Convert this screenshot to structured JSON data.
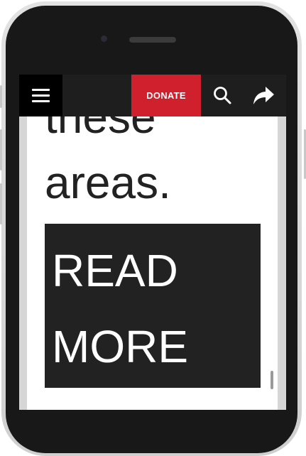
{
  "content": {
    "partial_text": "these",
    "areas_text": "areas.",
    "read_more_line1": "READ",
    "read_more_line2": "MORE"
  },
  "navbar": {
    "menu_icon": "hamburger-menu-icon",
    "donate_label": "DONATE",
    "search_icon": "search-icon",
    "share_icon": "share-arrow-icon"
  },
  "colors": {
    "navbar_bg": "#1e1e1e",
    "menu_bg": "#000000",
    "donate_bg": "#d0202e",
    "text_dark": "#222222",
    "read_more_bg": "#222222"
  }
}
